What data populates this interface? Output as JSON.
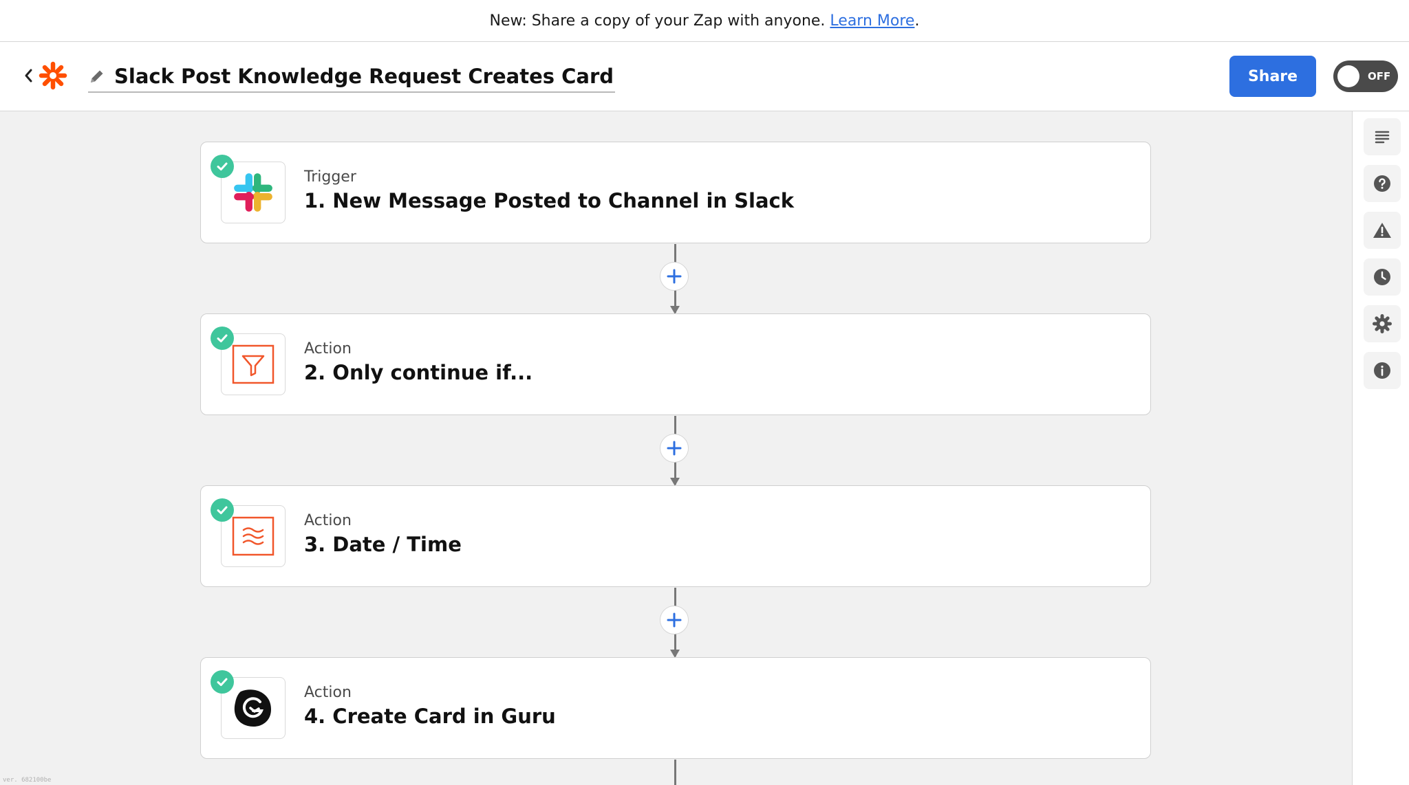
{
  "banner": {
    "text": "New: Share a copy of your Zap with anyone.",
    "link_text": "Learn More",
    "suffix": "."
  },
  "header": {
    "title": "Slack Post Knowledge Request Creates Card",
    "share_label": "Share",
    "toggle_label": "OFF"
  },
  "steps": [
    {
      "type": "Trigger",
      "title": "1. New Message Posted to Channel in Slack",
      "icon": "slack-icon"
    },
    {
      "type": "Action",
      "title": "2. Only continue if...",
      "icon": "filter-icon"
    },
    {
      "type": "Action",
      "title": "3. Date / Time",
      "icon": "formatter-icon"
    },
    {
      "type": "Action",
      "title": "4. Create Card in Guru",
      "icon": "guru-icon"
    }
  ],
  "right_panel": [
    "outline-icon",
    "help-icon",
    "warning-icon",
    "history-icon",
    "settings-icon",
    "info-icon"
  ],
  "footer": {
    "version": "ver. 682100be"
  },
  "colors": {
    "primary": "#2d6fe0",
    "success": "#3fc69c",
    "zapier_orange": "#ff4f00",
    "canvas_bg": "#f1f1f1",
    "toggle_off": "#4a4a4a"
  }
}
